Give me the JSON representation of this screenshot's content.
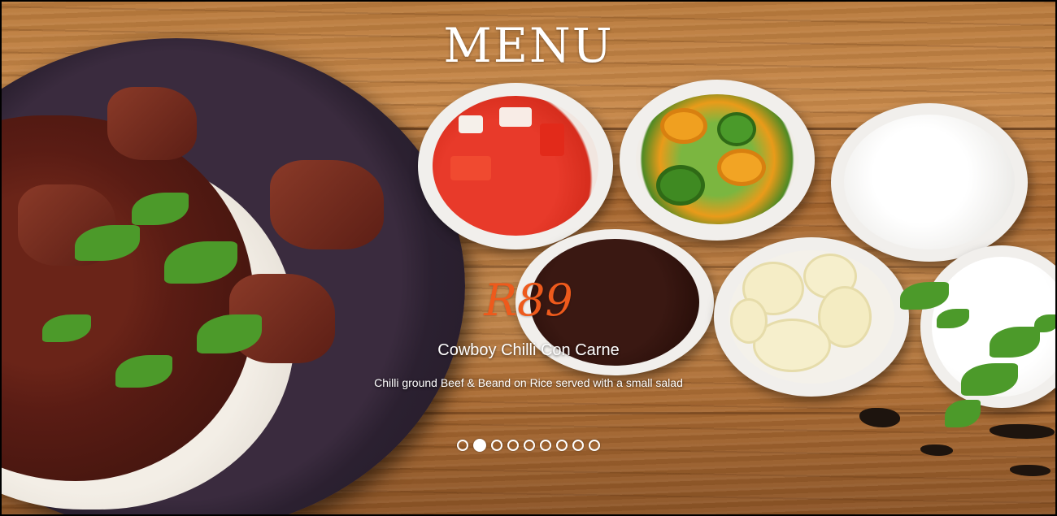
{
  "page": {
    "title": "MENU"
  },
  "slide": {
    "price": "R89",
    "dish_name": "Cowboy Chilli Con Carne",
    "description": "Chilli ground Beef & Beand on Rice served with a small salad"
  },
  "carousel": {
    "total_slides": 9,
    "active_index": 1
  },
  "colors": {
    "price_accent": "#ee5a1c",
    "title_text": "#ffffff"
  }
}
